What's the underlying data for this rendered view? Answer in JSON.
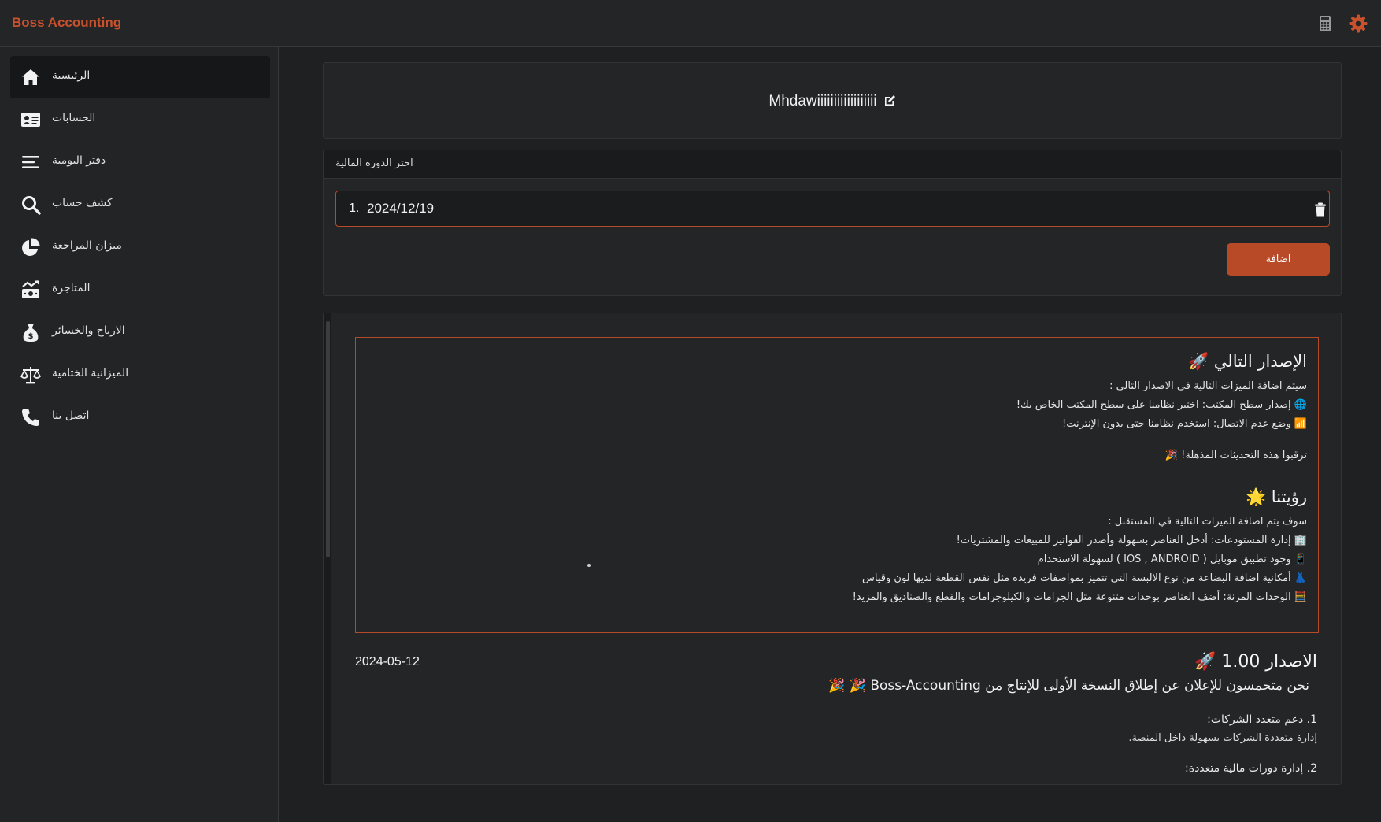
{
  "app": {
    "title": "Boss Accounting",
    "accent_color": "#c9512c",
    "top_icons": [
      "calculator-icon",
      "settings-gear-icon"
    ]
  },
  "sidebar": {
    "items": [
      {
        "label": "الرئيسية",
        "icon": "home-icon",
        "active": true
      },
      {
        "label": "الحسابات",
        "icon": "id-card-icon",
        "active": false
      },
      {
        "label": "دفتر اليومية",
        "icon": "menu-lines-icon",
        "active": false
      },
      {
        "label": "كشف حساب",
        "icon": "search-icon",
        "active": false
      },
      {
        "label": "ميزان المراجعة",
        "icon": "pie-chart-icon",
        "active": false
      },
      {
        "label": "المتاجرة",
        "icon": "trading-icon",
        "active": false
      },
      {
        "label": "الارباح والخسائر",
        "icon": "money-bag-icon",
        "active": false
      },
      {
        "label": "الميزانية الختامية",
        "icon": "scale-icon",
        "active": false
      },
      {
        "label": "اتصل بنا",
        "icon": "phone-icon",
        "active": false
      }
    ]
  },
  "company": {
    "name": "Mhdawiiiiiiiiiiiiiiiiii"
  },
  "financial_cycle": {
    "header": "اختر الدورة المالية",
    "items": [
      {
        "index": "1.",
        "date": "2024/12/19"
      }
    ],
    "add_label": "اضافة"
  },
  "news": {
    "upcoming": {
      "title": "الإصدار التالي 🚀",
      "intro": "سيتم اضافة الميزات التالية في الاصدار التالي :",
      "features": [
        "🌐 إصدار سطح المكتب: اختبر نظامنا على سطح المكتب الخاص بك!",
        "📶 وضع عدم الاتصال: استخدم نظامنا حتى بدون الإنترنت!"
      ],
      "footer": "ترقبوا هذه التحديثات المذهلة! 🎉"
    },
    "vision": {
      "title": "رؤيتنا 🌟",
      "intro": "سوف يتم اضافة الميزات التالية في المستقبل :",
      "features": [
        "🏢 إدارة المستودعات: أدخل العناصر بسهولة وأصدر الفواتير للمبيعات والمشتريات!",
        "📱 وجود تطبيق موبايل ( IOS , ANDROID ) لسهولة الاستخدام",
        "👗 أمكانية اضافة البضاعة من نوع الالبسة التي تتميز بمواصفات فريدة مثل نفس القطعة لديها لون وقياس",
        "🧮 الوحدات المرنة: أضف العناصر بوحدات متنوعة مثل الجرامات والكيلوجرامات والقطع والصناديق والمزيد!"
      ]
    },
    "release": {
      "title": "الاصدار 1.00 🚀",
      "date": "2024-05-12",
      "description": "نحن متحمسون للإعلان عن إطلاق النسخة الأولى للإنتاج من Boss-Accounting 🎉 🎉",
      "items": [
        {
          "title": "1. دعم متعدد الشركات:",
          "desc": "إدارة متعددة الشركات بسهولة داخل المنصة."
        },
        {
          "title": "2. إدارة دورات مالية متعددة:",
          "desc": ""
        }
      ]
    }
  }
}
